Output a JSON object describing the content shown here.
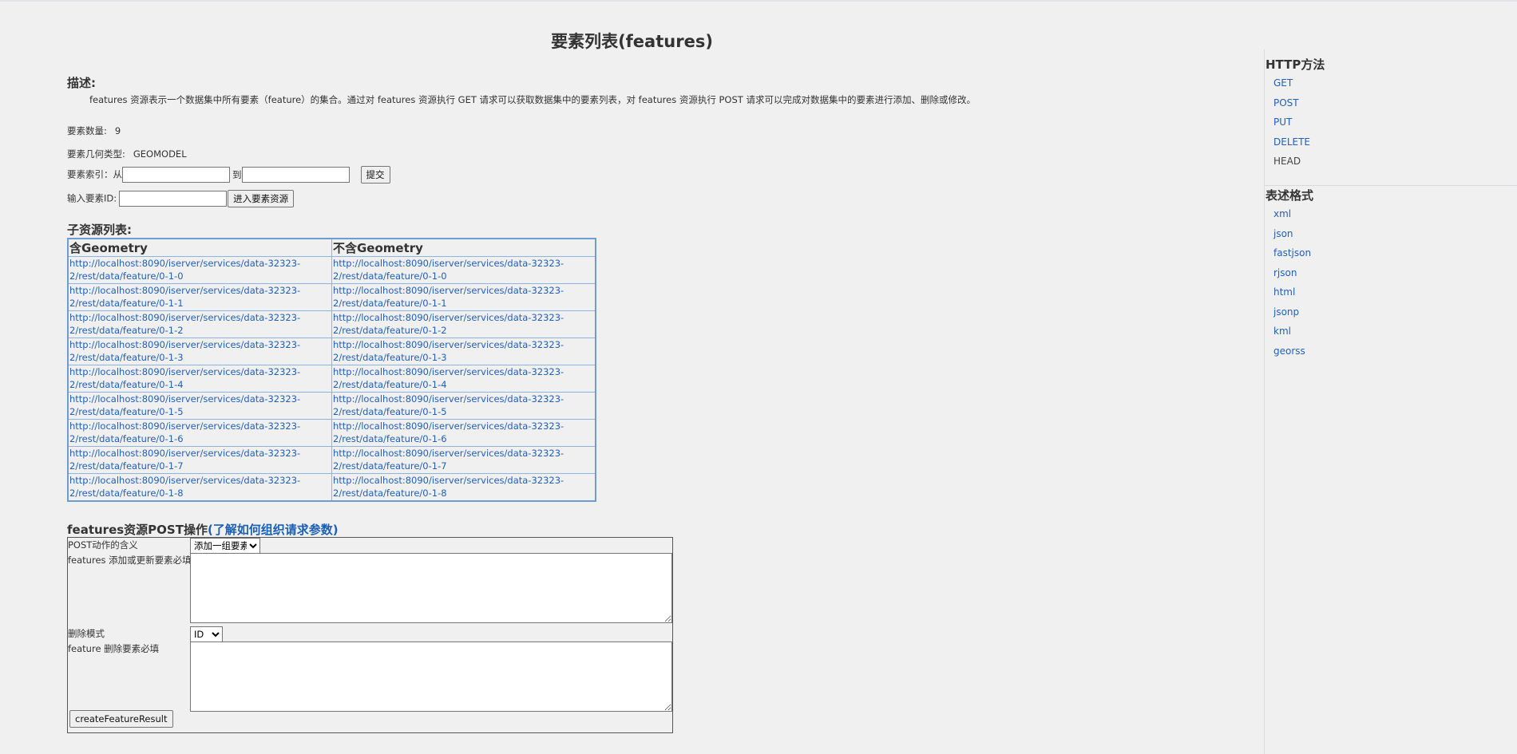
{
  "page": {
    "title": "要素列表(features)"
  },
  "description": {
    "label": "描述:",
    "text": "features 资源表示一个数据集中所有要素（feature）的集合。通过对 features 资源执行 GET 请求可以获取数据集中的要素列表，对 features 资源执行 POST 请求可以完成对数据集中的要素进行添加、删除或修改。"
  },
  "info": {
    "count_label": "要素数量:",
    "count_value": "9",
    "geom_label": "要素几何类型:",
    "geom_value": "GEOMODEL",
    "index_label": "要素索引：从",
    "index_to": "到",
    "index_submit": "提交",
    "id_label": "输入要素ID:",
    "id_submit": "进入要素资源"
  },
  "resources": {
    "label": "子资源列表:",
    "col_with_geometry": "含Geometry",
    "col_without_geometry": "不含Geometry",
    "rows": [
      {
        "with_line1": "http://localhost:8090/iserver/services/data-32323-",
        "with_line2": "2/rest/data/feature/0-1-0",
        "without_line1": "http://localhost:8090/iserver/services/data-32323-",
        "without_line2": "2/rest/data/feature/0-1-0"
      },
      {
        "with_line1": "http://localhost:8090/iserver/services/data-32323-",
        "with_line2": "2/rest/data/feature/0-1-1",
        "without_line1": "http://localhost:8090/iserver/services/data-32323-",
        "without_line2": "2/rest/data/feature/0-1-1"
      },
      {
        "with_line1": "http://localhost:8090/iserver/services/data-32323-",
        "with_line2": "2/rest/data/feature/0-1-2",
        "without_line1": "http://localhost:8090/iserver/services/data-32323-",
        "without_line2": "2/rest/data/feature/0-1-2"
      },
      {
        "with_line1": "http://localhost:8090/iserver/services/data-32323-",
        "with_line2": "2/rest/data/feature/0-1-3",
        "without_line1": "http://localhost:8090/iserver/services/data-32323-",
        "without_line2": "2/rest/data/feature/0-1-3"
      },
      {
        "with_line1": "http://localhost:8090/iserver/services/data-32323-",
        "with_line2": "2/rest/data/feature/0-1-4",
        "without_line1": "http://localhost:8090/iserver/services/data-32323-",
        "without_line2": "2/rest/data/feature/0-1-4"
      },
      {
        "with_line1": "http://localhost:8090/iserver/services/data-32323-",
        "with_line2": "2/rest/data/feature/0-1-5",
        "without_line1": "http://localhost:8090/iserver/services/data-32323-",
        "without_line2": "2/rest/data/feature/0-1-5"
      },
      {
        "with_line1": "http://localhost:8090/iserver/services/data-32323-",
        "with_line2": "2/rest/data/feature/0-1-6",
        "without_line1": "http://localhost:8090/iserver/services/data-32323-",
        "without_line2": "2/rest/data/feature/0-1-6"
      },
      {
        "with_line1": "http://localhost:8090/iserver/services/data-32323-",
        "with_line2": "2/rest/data/feature/0-1-7",
        "without_line1": "http://localhost:8090/iserver/services/data-32323-",
        "without_line2": "2/rest/data/feature/0-1-7"
      },
      {
        "with_line1": "http://localhost:8090/iserver/services/data-32323-",
        "with_line2": "2/rest/data/feature/0-1-8",
        "without_line1": "http://localhost:8090/iserver/services/data-32323-",
        "without_line2": "2/rest/data/feature/0-1-8"
      }
    ]
  },
  "post": {
    "label": "features资源POST操作",
    "help_link": "(了解如何组织请求参数)",
    "action_label": "POST动作的含义",
    "action_selected": "添加一组要素",
    "features_label": "features 添加或更新要素必填",
    "delete_mode_label": "删除模式",
    "delete_mode_selected": "ID",
    "feature_delete_label": "feature 删除要素必填",
    "submit_label": "createFeatureResult"
  },
  "sidebar": {
    "http_title": "HTTP方法",
    "methods": [
      "GET",
      "POST",
      "PUT",
      "DELETE",
      "HEAD"
    ],
    "format_title": "表述格式",
    "formats": [
      "xml",
      "json",
      "fastjson",
      "rjson",
      "html",
      "jsonp",
      "kml",
      "georss"
    ]
  },
  "colors": {
    "link": "#2260b8",
    "table_border": "#6a9ed2",
    "background": "#f0f0f0"
  }
}
